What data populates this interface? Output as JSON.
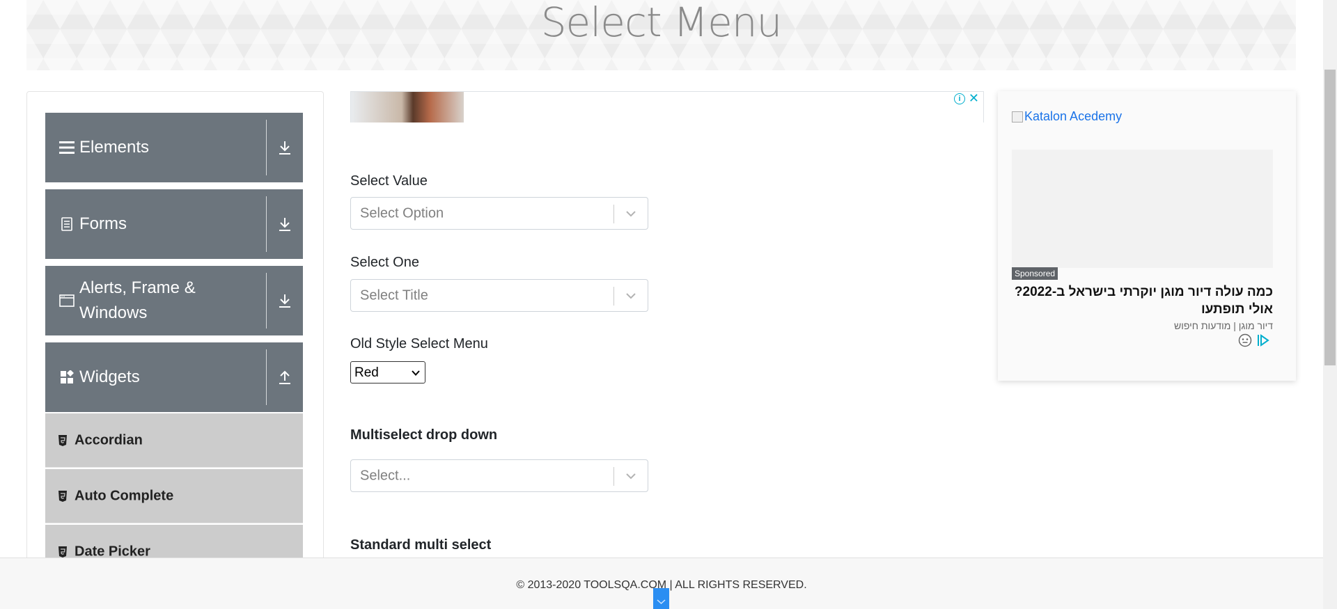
{
  "header": {
    "title": "Select Menu"
  },
  "sidebar": {
    "groups": [
      {
        "label": "Elements",
        "icon": "hamburger-icon",
        "arrow": "download-icon"
      },
      {
        "label": "Forms",
        "icon": "document-icon",
        "arrow": "download-icon"
      },
      {
        "label": "Alerts, Frame & Windows",
        "icon": "window-icon",
        "arrow": "download-icon"
      },
      {
        "label": "Widgets",
        "icon": "widgets-icon",
        "arrow": "upload-icon"
      }
    ],
    "widget_items": [
      {
        "label": "Accordian",
        "icon": "html5-icon"
      },
      {
        "label": "Auto Complete",
        "icon": "html5-icon"
      },
      {
        "label": "Date Picker",
        "icon": "html5-icon"
      }
    ]
  },
  "main": {
    "select_value": {
      "label": "Select Value",
      "placeholder": "Select Option"
    },
    "select_one": {
      "label": "Select One",
      "placeholder": "Select Title"
    },
    "old_style": {
      "label": "Old Style Select Menu",
      "selected": "Red"
    },
    "multiselect": {
      "label": "Multiselect drop down",
      "placeholder": "Select..."
    },
    "standard_multi": {
      "label": "Standard multi select"
    }
  },
  "ad": {
    "logo_alt": "Katalon Acedemy",
    "sponsored": "Sponsored",
    "title": "כמה עולה דיור מוגן יוקרתי בישראל ב-2022? אולי תופתעו",
    "subtitle": "דיור מוגן | מודעות חיפוש"
  },
  "footer": {
    "text": "© 2013-2020 TOOLSQA.COM | ALL RIGHTS RESERVED."
  },
  "colors": {
    "sidebar_group": "#6c757d",
    "sidebar_subitem": "#cccccc",
    "accent": "#2b8ef2"
  }
}
